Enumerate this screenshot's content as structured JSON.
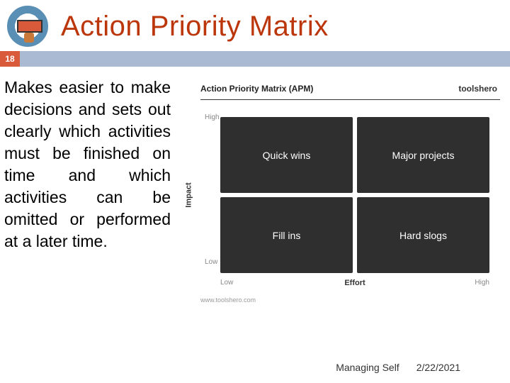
{
  "header": {
    "title": "Action Priority Matrix",
    "page_number": "18"
  },
  "body_text": "Makes easier to make decisions and sets out clearly which activities must be finished on time and which activities can be omitted or performed at a later time.",
  "chart_data": {
    "type": "table",
    "title": "Action Priority Matrix (APM)",
    "brand": "toolshero",
    "xlabel": "Effort",
    "ylabel": "Impact",
    "x_ticks": [
      "Low",
      "High"
    ],
    "y_ticks": [
      "High",
      "Low"
    ],
    "quadrants": {
      "high_impact_low_effort": "Quick wins",
      "high_impact_high_effort": "Major projects",
      "low_impact_low_effort": "Fill ins",
      "low_impact_high_effort": "Hard slogs"
    },
    "source": "www.toolshero.com"
  },
  "footer": {
    "topic": "Managing Self",
    "date": "2/22/2021"
  }
}
